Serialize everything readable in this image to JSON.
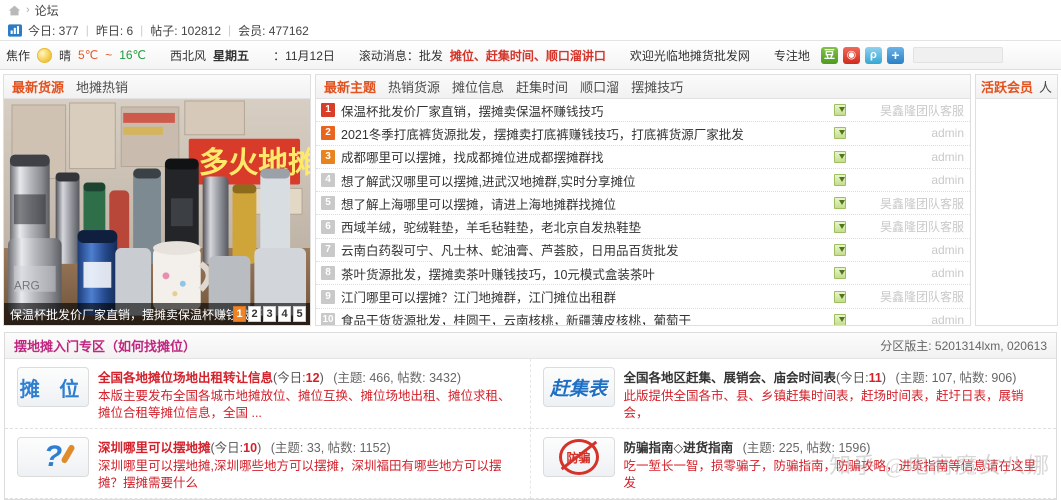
{
  "breadcrumb": {
    "home_icon": "home-icon",
    "separator": "›",
    "current": "论坛"
  },
  "stats": {
    "icon": "chart-bar-icon",
    "today": "今日: 377",
    "yesterday": "昨日: 6",
    "posts": "帖子: 102812",
    "members": "会员: 477162",
    "divider": "|"
  },
  "weather": {
    "city": "焦作",
    "sun_icon": "sun-icon",
    "condition": "晴",
    "temp_low": "5℃",
    "temp_range_sep": "~",
    "temp_high": "16℃",
    "wind": "西北风",
    "weekday": "星期五",
    "date": "：11月12日",
    "marquee_label": "滚动消息：批发",
    "marquee_red": "摊位、赶集时间、顺口溜讲口",
    "welcome": "欢迎光临地摊货批发网",
    "focus": "专注地",
    "share_icons": [
      "douban-share-icon",
      "weibo-share-icon",
      "qzone-share-icon",
      "more-share-icon"
    ]
  },
  "left_panel": {
    "tabs": [
      {
        "label": "最新货源",
        "active": true
      },
      {
        "label": "地摊热销",
        "active": false
      }
    ],
    "slide": {
      "caption": "保温杯批发价厂家直销，摆摊卖保温杯赚钱技巧",
      "pages": [
        "1",
        "2",
        "3",
        "4",
        "5"
      ],
      "active_page": "1",
      "active_color": "#f08326"
    }
  },
  "topics_panel": {
    "tabs": [
      {
        "label": "最新主题",
        "active": true
      },
      {
        "label": "热销货源",
        "active": false
      },
      {
        "label": "摊位信息",
        "active": false
      },
      {
        "label": "赶集时间",
        "active": false
      },
      {
        "label": "顺口溜",
        "active": false
      },
      {
        "label": "摆摊技巧",
        "active": false
      }
    ],
    "rows": [
      {
        "rank": "1",
        "title": "保温杯批发价厂家直销，摆摊卖保温杯赚钱技巧",
        "attachment": "image-attachment-icon",
        "author": "昊鑫隆团队客服"
      },
      {
        "rank": "2",
        "title": "2021冬季打底裤货源批发，摆摊卖打底裤赚钱技巧，打底裤货源厂家批发",
        "attachment": "image-attachment-icon",
        "author": "admin"
      },
      {
        "rank": "3",
        "title": "成都哪里可以摆摊，找成都摊位进成都摆摊群找",
        "attachment": "image-attachment-icon",
        "author": "admin"
      },
      {
        "rank": "4",
        "title": "想了解武汉哪里可以摆摊,进武汉地摊群,实时分享摊位",
        "attachment": "image-attachment-icon",
        "author": "admin"
      },
      {
        "rank": "5",
        "title": "想了解上海哪里可以摆摊，请进上海地摊群找摊位",
        "attachment": "image-attachment-icon",
        "author": "昊鑫隆团队客服"
      },
      {
        "rank": "6",
        "title": "西域羊绒，驼绒鞋垫，羊毛毡鞋垫，老北京自发热鞋垫",
        "attachment": "image-attachment-icon",
        "author": "昊鑫隆团队客服"
      },
      {
        "rank": "7",
        "title": "云南白药裂可宁、凡士林、蛇油膏、芦荟胶，日用品百货批发",
        "attachment": "image-attachment-icon",
        "author": "admin"
      },
      {
        "rank": "8",
        "title": "茶叶货源批发，摆摊卖茶叶赚钱技巧，10元模式盒装茶叶",
        "attachment": "image-attachment-icon",
        "author": "admin"
      },
      {
        "rank": "9",
        "title": "江门哪里可以摆摊？江门地摊群，江门摊位出租群",
        "attachment": "image-attachment-icon",
        "author": "昊鑫隆团队客服"
      },
      {
        "rank": "10",
        "title": "食品干货货源批发，桂圆干，云南核桃，新疆薄皮核桃，葡萄干",
        "attachment": "image-attachment-icon",
        "author": "admin"
      }
    ]
  },
  "right_panel": {
    "tabs": [
      {
        "label": "活跃会员",
        "active": true
      },
      {
        "label": "人",
        "active": false
      }
    ]
  },
  "section": {
    "title": "摆地摊入门专区（如何找摊位）",
    "moderators": "分区版主: 5201314lxm, 020613",
    "boards": [
      {
        "icon_text": "摊 位",
        "icon_style": "tanwei",
        "name": "全国各地摊位场地出租转让信息",
        "today_prefix": "(今日:",
        "today_num": "12",
        "today_suffix": ")",
        "counts": "(主题: 466, 帖数: 3432)",
        "desc": "本版主要发布全国各城市地摊放位、摊位互换、摊位场地出租、摊位求租、摊位合租等摊位信息，全国 ..."
      },
      {
        "icon_text": "赶集表",
        "icon_style": "ganji",
        "name": "全国各地区赶集、展销会、庙会时间表",
        "today_prefix": "(今日:",
        "today_num": "11",
        "today_suffix": ")",
        "counts": "(主题: 107, 帖数: 906)",
        "desc": "此版提供全国各市、县、乡镇赶集时间表，赶场时间表，赶圩日表，展销会，"
      },
      {
        "icon_text": "?",
        "icon_style": "question",
        "name": "深圳哪里可以摆地摊",
        "today_prefix": "(今日:",
        "today_num": "10",
        "today_suffix": ")",
        "counts": "(主题: 33, 帖数: 1152)",
        "desc": "深圳哪里可以摆地摊,深圳哪些地方可以摆摊，深圳福田有哪些地方可以摆摊？摆摊需要什么"
      },
      {
        "icon_text": "防骗",
        "icon_style": "ban",
        "name": "防骗指南◇进货指南",
        "today_prefix": "",
        "today_num": "",
        "today_suffix": "",
        "counts": "(主题: 225, 帖数: 1596)",
        "desc": "吃一堑长一智，损零骗子，防骗指南，防骗攻略，进货指南等信息请在这里发"
      }
    ]
  },
  "watermark": {
    "text": "知乎 @电商魔女八娜"
  }
}
